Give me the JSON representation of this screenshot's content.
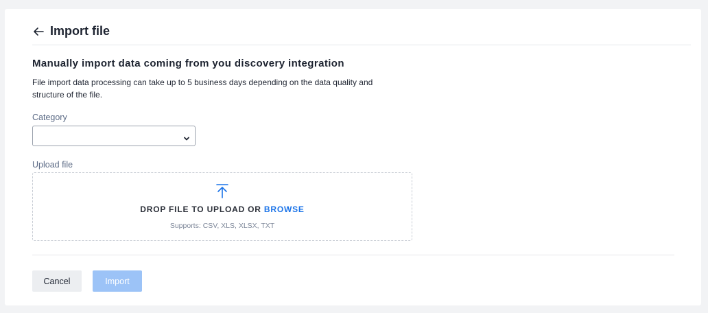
{
  "header": {
    "title": "Import file",
    "back_icon": "arrow-left-icon"
  },
  "section": {
    "title": "Manually import data coming from you discovery integration",
    "description": "File import data processing can take up to 5 business days depending on the data quality and structure of the file."
  },
  "category": {
    "label": "Category",
    "selected_value": "",
    "icon": "chevron-down-icon"
  },
  "upload": {
    "label": "Upload file",
    "icon": "upload-arrow-icon",
    "drop_text": "DROP FILE TO UPLOAD OR",
    "browse_label": "BROWSE",
    "supports_text": "Supports: CSV, XLS, XLSX, TXT"
  },
  "footer": {
    "cancel_label": "Cancel",
    "import_label": "Import"
  },
  "colors": {
    "accent": "#1a73e8",
    "import_disabled": "#9cc3f7",
    "background": "#f2f3f5",
    "card": "#ffffff"
  }
}
